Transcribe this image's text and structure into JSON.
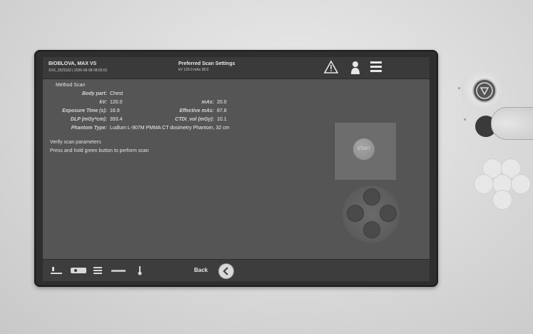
{
  "header": {
    "patient_name": "BIOBLOVA, MAX VS",
    "patient_id": "XXX_2021102 | 2026-09-08 08:03:01",
    "settings_title": "Preferred Scan Settings",
    "settings_subtitle": "kV 120.0  mAs 28.0"
  },
  "scan": {
    "title": "Method Scan",
    "body_part_label": "Body part:",
    "body_part_value": "Chest",
    "kv_label": "kV:",
    "kv_value": "120.0",
    "mas_label": "mAs:",
    "mas_value": "20.0",
    "exposure_label": "Exposure Time (s):",
    "exposure_value": "16.9",
    "eff_mas_label": "Effective mAs:",
    "eff_mas_value": "87.8",
    "dlp_label": "DLP (mGy*cm):",
    "dlp_value": "393.4",
    "ctdi_label": "CTDI_vol (mGy):",
    "ctdi_value": "10.1",
    "phantom_label": "Phantom Type:",
    "phantom_value": "Ludlum L-907M PMMA CT dosimetry Phantom, 32 cm"
  },
  "messages": {
    "verify": "Verify scan parameters",
    "press_hold": "Press and hold green button to perform scan"
  },
  "start_button": {
    "label": "START"
  },
  "bottom": {
    "back_label": "Back"
  },
  "icons": {
    "warning": "warning-triangle-icon",
    "person": "patient-icon",
    "menu": "menu-list-icon",
    "back": "chevron-left-icon"
  },
  "colors": {
    "screen_bg": "#555555",
    "bar_bg": "#3a3a3a",
    "text": "#e6e6e6"
  }
}
